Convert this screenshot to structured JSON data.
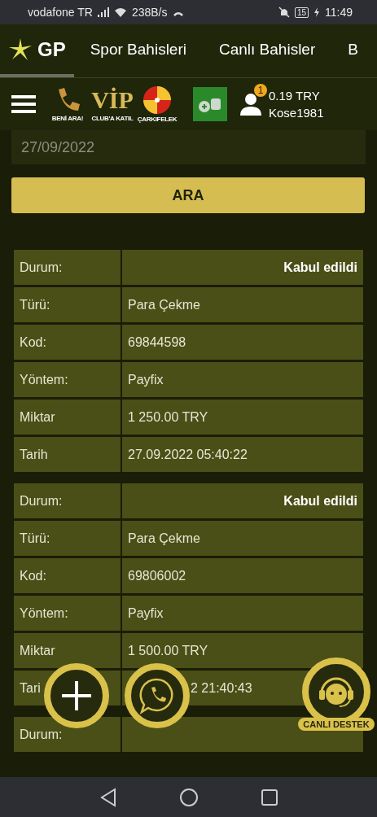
{
  "status_bar": {
    "carrier": "vodafone TR",
    "speed": "238B/s",
    "battery": "15",
    "time": "11:49"
  },
  "nav_tabs": [
    {
      "kind": "logo",
      "label": "GP",
      "selected": true
    },
    {
      "kind": "text",
      "label": "Spor Bahisleri",
      "selected": false
    },
    {
      "kind": "text",
      "label": "Canlı Bahisler",
      "selected": false
    },
    {
      "kind": "text",
      "label": "B",
      "selected": false
    }
  ],
  "toolbar": {
    "promos": [
      {
        "kind": "phone",
        "caption": "BENİ ARA!"
      },
      {
        "kind": "vip",
        "title": "VİP",
        "caption": "CLUB'A KATIL"
      },
      {
        "kind": "wheel",
        "caption": "ÇARKIFELEK"
      }
    ],
    "notification_count": "1",
    "balance": "0.19 TRY",
    "username": "Kose1981"
  },
  "date_field": {
    "value": "27/09/2022"
  },
  "search_button": "ARA",
  "transactions": [
    {
      "rows": [
        {
          "kind": "status",
          "label": "Durum:",
          "value": "Kabul edildi"
        },
        {
          "kind": "plain",
          "label": "Türü:",
          "value": "Para Çekme"
        },
        {
          "kind": "plain",
          "label": "Kod:",
          "value": "69844598"
        },
        {
          "kind": "plain",
          "label": "Yöntem:",
          "value": "Payfix"
        },
        {
          "kind": "plain",
          "label": "Miktar",
          "value": "1 250.00 TRY"
        },
        {
          "kind": "plain",
          "label": "Tarih",
          "value": "27.09.2022 05:40:22"
        }
      ]
    },
    {
      "rows": [
        {
          "kind": "status",
          "label": "Durum:",
          "value": "Kabul edildi"
        },
        {
          "kind": "plain",
          "label": "Türü:",
          "value": "Para Çekme"
        },
        {
          "kind": "plain",
          "label": "Kod:",
          "value": "69806002"
        },
        {
          "kind": "plain",
          "label": "Yöntem:",
          "value": "Payfix"
        },
        {
          "kind": "plain",
          "label": "Miktar",
          "value": "1 500.00 TRY"
        },
        {
          "kind": "partial",
          "label": "Tari",
          "value": "2 21:40:43"
        }
      ]
    },
    {
      "rows": [
        {
          "kind": "status",
          "label": "Durum:"
        }
      ]
    }
  ],
  "support_label": "CANLI DESTEK"
}
